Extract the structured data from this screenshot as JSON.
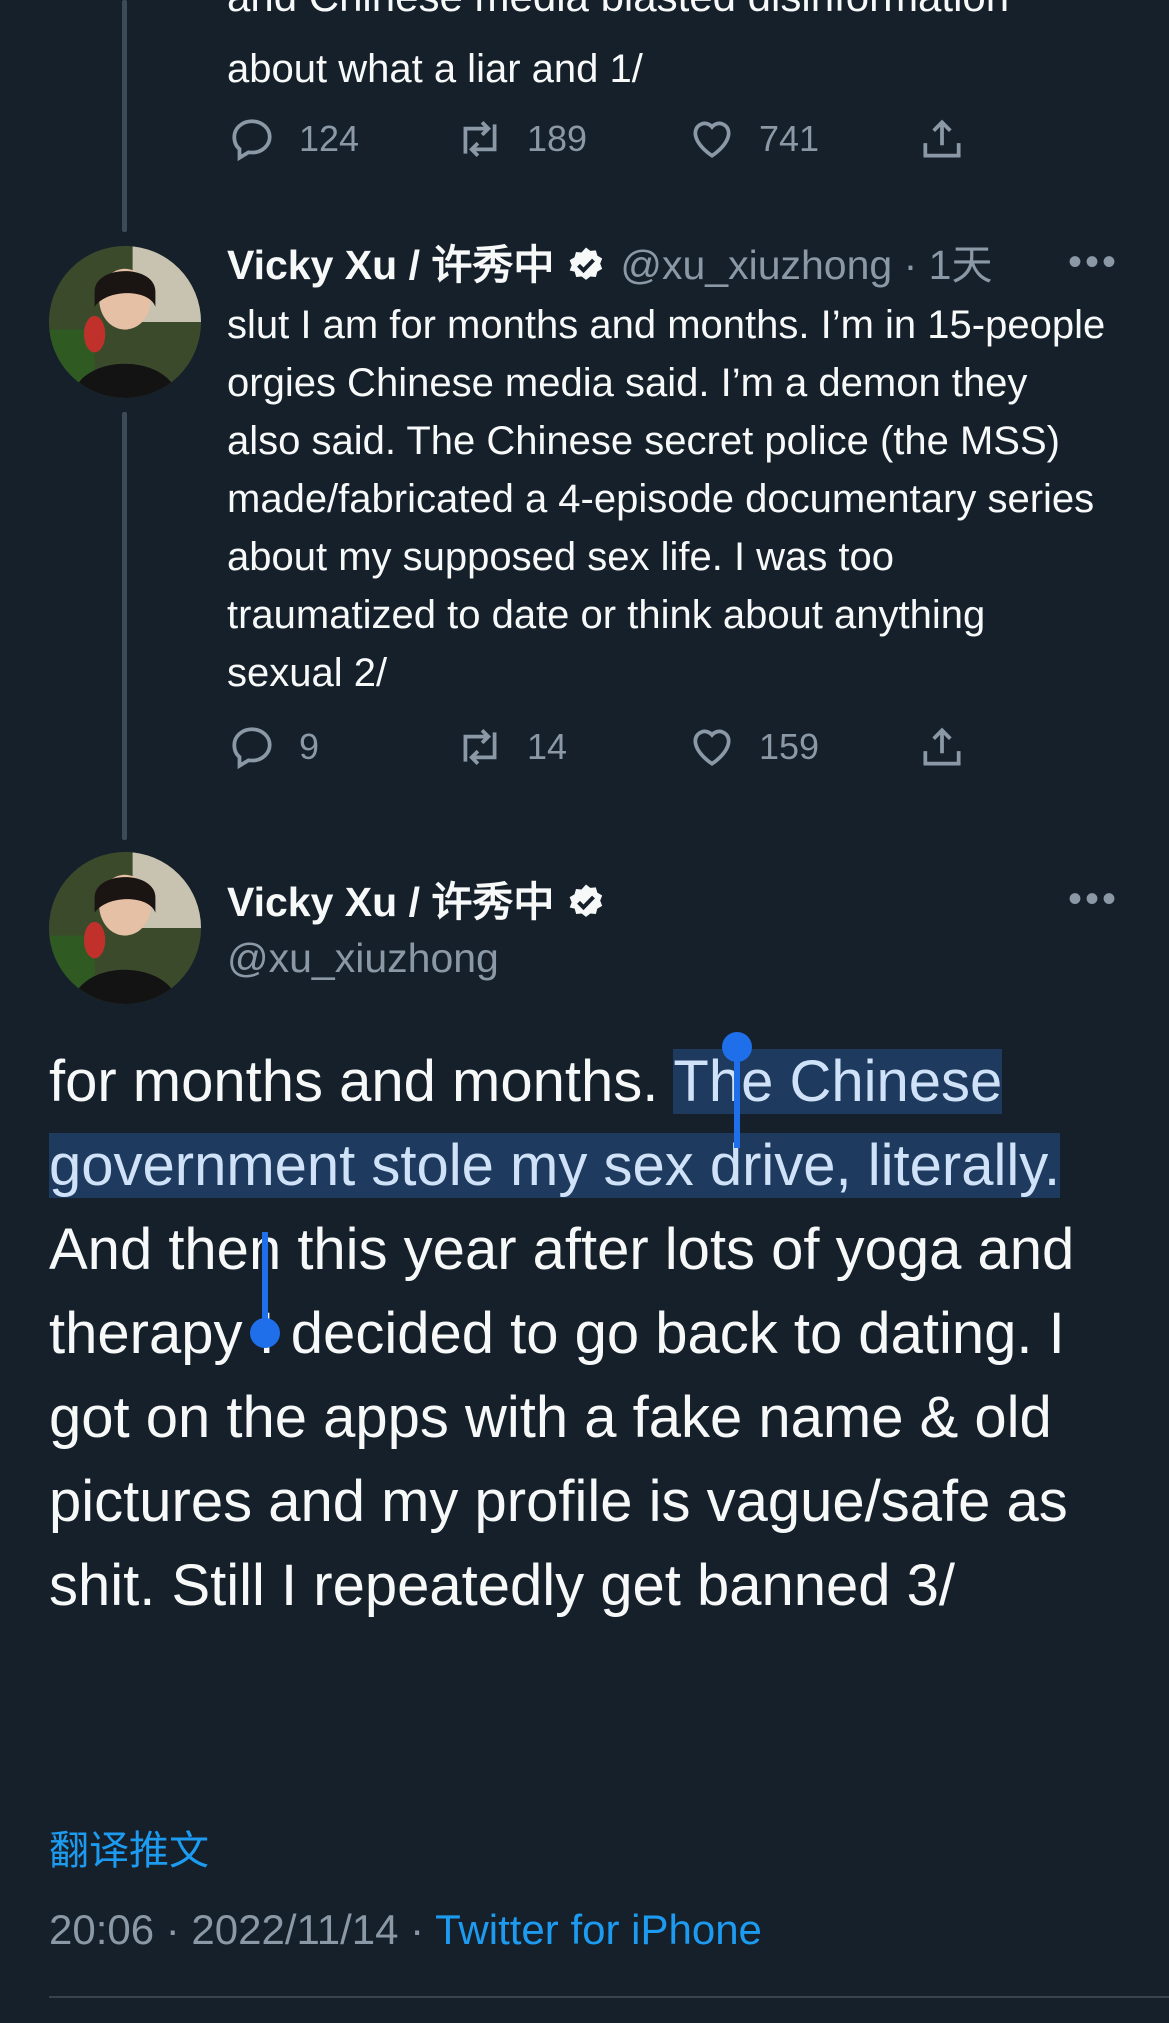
{
  "colors": {
    "background": "#15202b",
    "text": "#f7f9f9",
    "muted": "#8b98a5",
    "link": "#1d9bf0",
    "selection": "#1e3a5f",
    "selection_handle": "#1f6feb"
  },
  "prev_tweet": {
    "cut_text": "and Chinese media blasted disinformation",
    "text_tail": "about what a liar and 1/",
    "actions": {
      "replies": "124",
      "retweets": "189",
      "likes": "741"
    }
  },
  "tweet2": {
    "name": "Vicky Xu / 许秀中",
    "handle_time": "@xu_xiuzhong · 1天",
    "text": "slut I am for months and months. I’m in 15-people orgies Chinese media said. I’m a demon they also said. The Chinese secret police (the MSS) made/fabricated a 4-episode documentary series about my supposed sex life. I was too traumatized to date or think about anything sexual 2/",
    "actions": {
      "replies": "9",
      "retweets": "14",
      "likes": "159"
    }
  },
  "main_tweet": {
    "name": "Vicky Xu / 许秀中",
    "handle": "@xu_xiuzhong",
    "text_before": "for months and months. ",
    "text_selected": "The Chinese government stole my sex drive, literally.",
    "text_after": " And then this year after lots of yoga and therapy I decided to go back to dating. I got on the apps with a fake name & old pictures and my profile is vague/safe as shit. Still I repeatedly get banned 3/",
    "translate": "翻译推文",
    "time_date": "20:06 · 2022/11/14 · ",
    "source": "Twitter for iPhone"
  },
  "icons": [
    "reply-icon",
    "retweet-icon",
    "like-icon",
    "share-icon",
    "verified-badge-icon",
    "more-icon"
  ],
  "more_glyph": "•••"
}
